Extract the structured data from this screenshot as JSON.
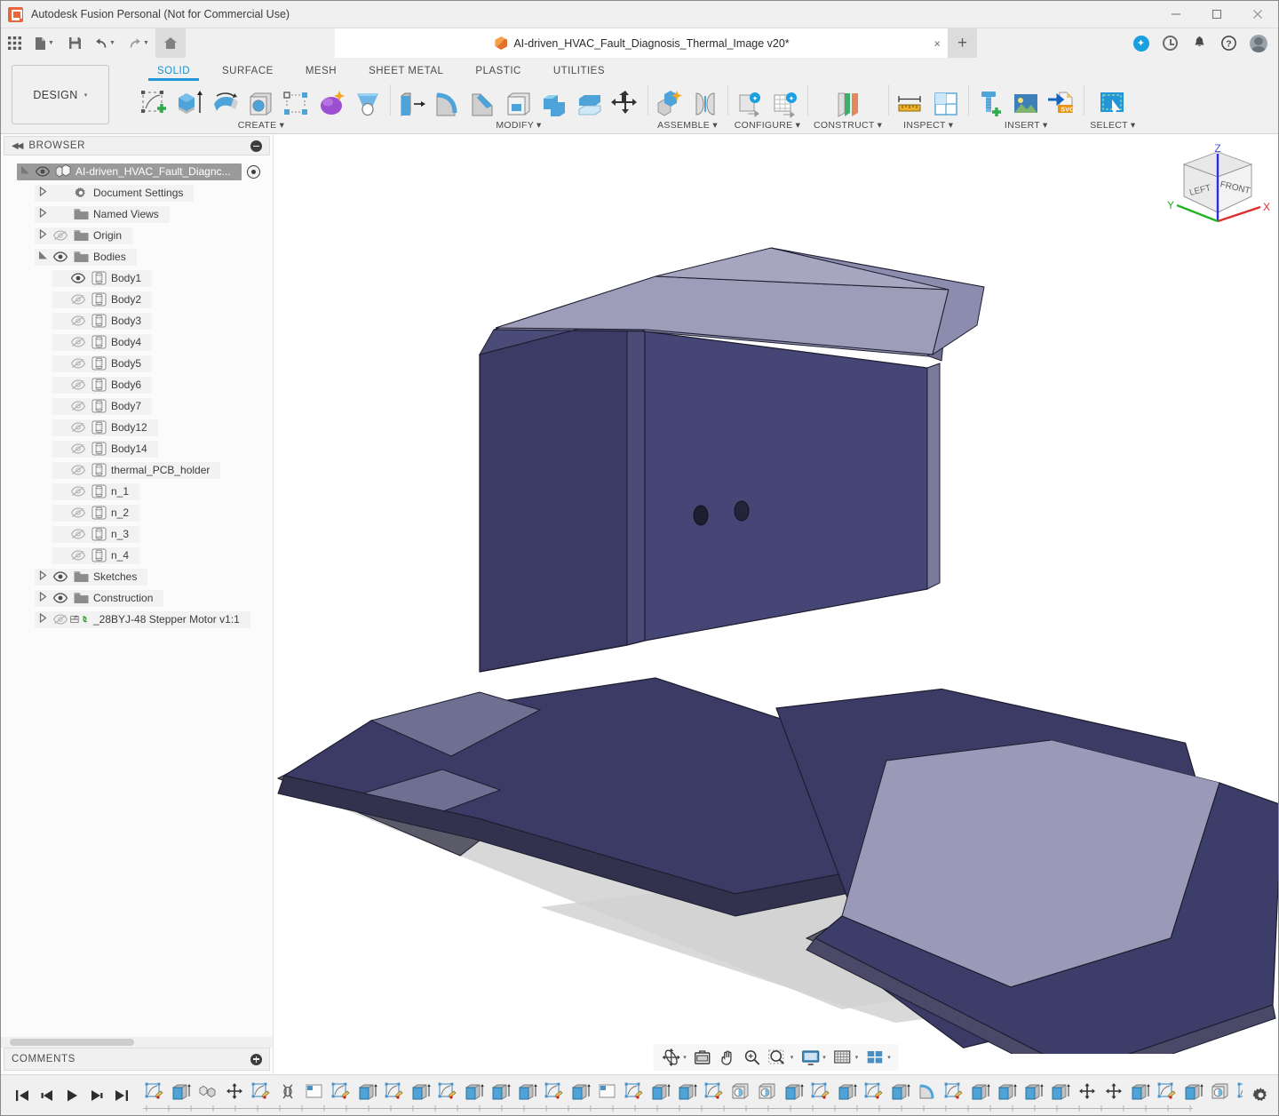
{
  "window": {
    "title": "Autodesk Fusion Personal (Not for Commercial Use)",
    "minimize_label": "—",
    "maximize_label": "□",
    "close_label": "✕",
    "app_icon": "fusion-logo-icon"
  },
  "quick_access": {
    "grid_label": "apps-grid-icon",
    "new_label": "new-document-icon",
    "save_label": "save-icon",
    "undo_label": "undo-icon",
    "redo_label": "redo-icon",
    "home_label": "home-icon",
    "add_tab_label": "+",
    "extensions_label": "extensions-icon",
    "recent_label": "recent-icon",
    "notifications_label": "bell-icon",
    "help_label": "help-icon",
    "account_label": "account-avatar"
  },
  "document_tab": {
    "title": "AI-driven_HVAC_Fault_Diagnosis_Thermal_Image v20*",
    "close_label": "×"
  },
  "workspace": {
    "selector_label": "DESIGN",
    "selector_caret": "▾"
  },
  "ribbon": {
    "tabs": [
      {
        "label": "SOLID",
        "active": true
      },
      {
        "label": "SURFACE",
        "active": false
      },
      {
        "label": "MESH",
        "active": false
      },
      {
        "label": "SHEET METAL",
        "active": false
      },
      {
        "label": "PLASTIC",
        "active": false
      },
      {
        "label": "UTILITIES",
        "active": false
      }
    ],
    "groups": [
      {
        "label": "CREATE",
        "caret": "▾",
        "tools": [
          "create-sketch-icon",
          "extrude-icon",
          "revolve-icon",
          "hole-icon",
          "rectangular-pattern-icon",
          "form-icon",
          "loft-icon"
        ]
      },
      {
        "label": "MODIFY",
        "caret": "▾",
        "tools": [
          "press-pull-icon",
          "fillet-icon",
          "chamfer-icon",
          "shell-icon",
          "combine-icon",
          "split-face-icon",
          "move-copy-icon"
        ]
      },
      {
        "label": "ASSEMBLE",
        "caret": "▾",
        "tools": [
          "new-component-icon",
          "joint-icon"
        ]
      },
      {
        "label": "CONFIGURE",
        "caret": "▾",
        "tools": [
          "configuration-icon",
          "configuration-table-icon"
        ]
      },
      {
        "label": "CONSTRUCT",
        "caret": "▾",
        "tools": [
          "offset-plane-icon"
        ]
      },
      {
        "label": "INSPECT",
        "caret": "▾",
        "tools": [
          "measure-icon",
          "section-analysis-icon"
        ]
      },
      {
        "label": "INSERT",
        "caret": "▾",
        "tools": [
          "insert-mcmaster-icon",
          "insert-image-icon",
          "insert-svg-icon"
        ]
      },
      {
        "label": "SELECT",
        "caret": "▾",
        "tools": [
          "select-window-icon"
        ]
      }
    ]
  },
  "browser": {
    "header": "BROWSER",
    "collapse_label": "◀◀",
    "minimize_label": "minus-circle-icon",
    "nodes": [
      {
        "label": "AI-driven_HVAC_Fault_Diagnc...",
        "indent": 0,
        "arrow": "expanded",
        "eye": "visible",
        "icon": "component-icon",
        "selected": true,
        "radio": true
      },
      {
        "label": "Document Settings",
        "indent": 1,
        "arrow": "collapsed",
        "eye": "none",
        "icon": "gear-icon",
        "selected": false,
        "radio": false
      },
      {
        "label": "Named Views",
        "indent": 1,
        "arrow": "collapsed",
        "eye": "none",
        "icon": "folder-icon",
        "selected": false,
        "radio": false
      },
      {
        "label": "Origin",
        "indent": 1,
        "arrow": "collapsed",
        "eye": "hidden",
        "icon": "folder-icon",
        "selected": false,
        "radio": false
      },
      {
        "label": "Bodies",
        "indent": 1,
        "arrow": "expanded",
        "eye": "visible",
        "icon": "folder-icon",
        "selected": false,
        "radio": false
      },
      {
        "label": "Body1",
        "indent": 2,
        "arrow": "none",
        "eye": "visible",
        "icon": "body-icon",
        "selected": false,
        "radio": false
      },
      {
        "label": "Body2",
        "indent": 2,
        "arrow": "none",
        "eye": "hidden",
        "icon": "body-icon",
        "selected": false,
        "radio": false
      },
      {
        "label": "Body3",
        "indent": 2,
        "arrow": "none",
        "eye": "hidden",
        "icon": "body-icon",
        "selected": false,
        "radio": false
      },
      {
        "label": "Body4",
        "indent": 2,
        "arrow": "none",
        "eye": "hidden",
        "icon": "body-icon",
        "selected": false,
        "radio": false
      },
      {
        "label": "Body5",
        "indent": 2,
        "arrow": "none",
        "eye": "hidden",
        "icon": "body-icon",
        "selected": false,
        "radio": false
      },
      {
        "label": "Body6",
        "indent": 2,
        "arrow": "none",
        "eye": "hidden",
        "icon": "body-icon",
        "selected": false,
        "radio": false
      },
      {
        "label": "Body7",
        "indent": 2,
        "arrow": "none",
        "eye": "hidden",
        "icon": "body-icon",
        "selected": false,
        "radio": false
      },
      {
        "label": "Body12",
        "indent": 2,
        "arrow": "none",
        "eye": "hidden",
        "icon": "body-icon",
        "selected": false,
        "radio": false
      },
      {
        "label": "Body14",
        "indent": 2,
        "arrow": "none",
        "eye": "hidden",
        "icon": "body-icon",
        "selected": false,
        "radio": false
      },
      {
        "label": "thermal_PCB_holder",
        "indent": 2,
        "arrow": "none",
        "eye": "hidden",
        "icon": "body-icon",
        "selected": false,
        "radio": false
      },
      {
        "label": "n_1",
        "indent": 2,
        "arrow": "none",
        "eye": "hidden",
        "icon": "body-icon",
        "selected": false,
        "radio": false
      },
      {
        "label": "n_2",
        "indent": 2,
        "arrow": "none",
        "eye": "hidden",
        "icon": "body-icon",
        "selected": false,
        "radio": false
      },
      {
        "label": "n_3",
        "indent": 2,
        "arrow": "none",
        "eye": "hidden",
        "icon": "body-icon",
        "selected": false,
        "radio": false
      },
      {
        "label": "n_4",
        "indent": 2,
        "arrow": "none",
        "eye": "hidden",
        "icon": "body-icon",
        "selected": false,
        "radio": false
      },
      {
        "label": "Sketches",
        "indent": 1,
        "arrow": "collapsed",
        "eye": "visible",
        "icon": "folder-icon",
        "selected": false,
        "radio": false
      },
      {
        "label": "Construction",
        "indent": 1,
        "arrow": "collapsed",
        "eye": "visible",
        "icon": "folder-icon",
        "selected": false,
        "radio": false
      },
      {
        "label": "_28BYJ-48 Stepper Motor v1:1",
        "indent": 1,
        "arrow": "collapsed",
        "eye": "hidden",
        "icon": "linked-component-icon",
        "selected": false,
        "radio": false
      }
    ]
  },
  "comments": {
    "header": "COMMENTS",
    "add_label": "plus-circle-icon"
  },
  "viewcube": {
    "front_face": "FRONT",
    "left_face": "LEFT",
    "axis_z": "Z",
    "axis_x": "X",
    "axis_y": "Y",
    "color_z": "#2d2de0",
    "color_x": "#e02d2d",
    "color_y": "#22b422"
  },
  "navbar": {
    "buttons": [
      {
        "name": "orbit-icon",
        "caret": "▾"
      },
      {
        "name": "look-at-icon",
        "caret": ""
      },
      {
        "name": "pan-icon",
        "caret": ""
      },
      {
        "name": "zoom-icon",
        "caret": ""
      },
      {
        "name": "zoom-window-icon",
        "caret": "▾"
      },
      {
        "name": "display-settings-icon",
        "caret": "▾"
      },
      {
        "name": "grid-snap-icon",
        "caret": "▾"
      },
      {
        "name": "viewports-icon",
        "caret": "▾"
      }
    ]
  },
  "canvas": {
    "model_color_front": "#3d3d6e",
    "model_color_side": "#464674",
    "model_color_top": "#9a9ab8",
    "model_color_edge": "#1c1c2e",
    "shadow_color": "#d0d0d0",
    "background": "#ffffff"
  },
  "timeline": {
    "playback": [
      "go-to-beginning-icon",
      "step-back-icon",
      "play-icon",
      "step-forward-icon",
      "go-to-end-icon"
    ],
    "settings_label": "timeline-settings-gear-icon",
    "features": [
      "sketch-icon",
      "extrude-icon",
      "component-icon",
      "move-icon",
      "sketch-icon",
      "joint-icon",
      "plane-icon",
      "sketch-icon",
      "extrude-icon",
      "sketch-icon",
      "extrude-icon",
      "sketch-icon",
      "extrude-icon",
      "extrude-icon",
      "extrude-icon",
      "sketch-icon",
      "extrude-icon",
      "plane-icon",
      "sketch-icon",
      "extrude-icon",
      "extrude-icon",
      "sketch-icon",
      "hole-icon",
      "hole-icon",
      "extrude-icon",
      "sketch-icon",
      "extrude-icon",
      "sketch-icon",
      "extrude-icon",
      "fillet-icon",
      "sketch-icon",
      "extrude-icon",
      "extrude-icon",
      "extrude-icon",
      "extrude-icon",
      "move-icon",
      "move-icon",
      "extrude-icon",
      "sketch-icon",
      "extrude-icon",
      "hole-icon",
      "sketch-icon",
      "extrude-icon",
      "sketch-icon",
      "extrude-icon",
      "sketch-icon",
      "extrude-icon",
      "extrude-icon",
      "sketch-icon",
      "extrude-icon",
      "sketch-icon",
      "extrude-icon",
      "fillet-icon"
    ]
  }
}
